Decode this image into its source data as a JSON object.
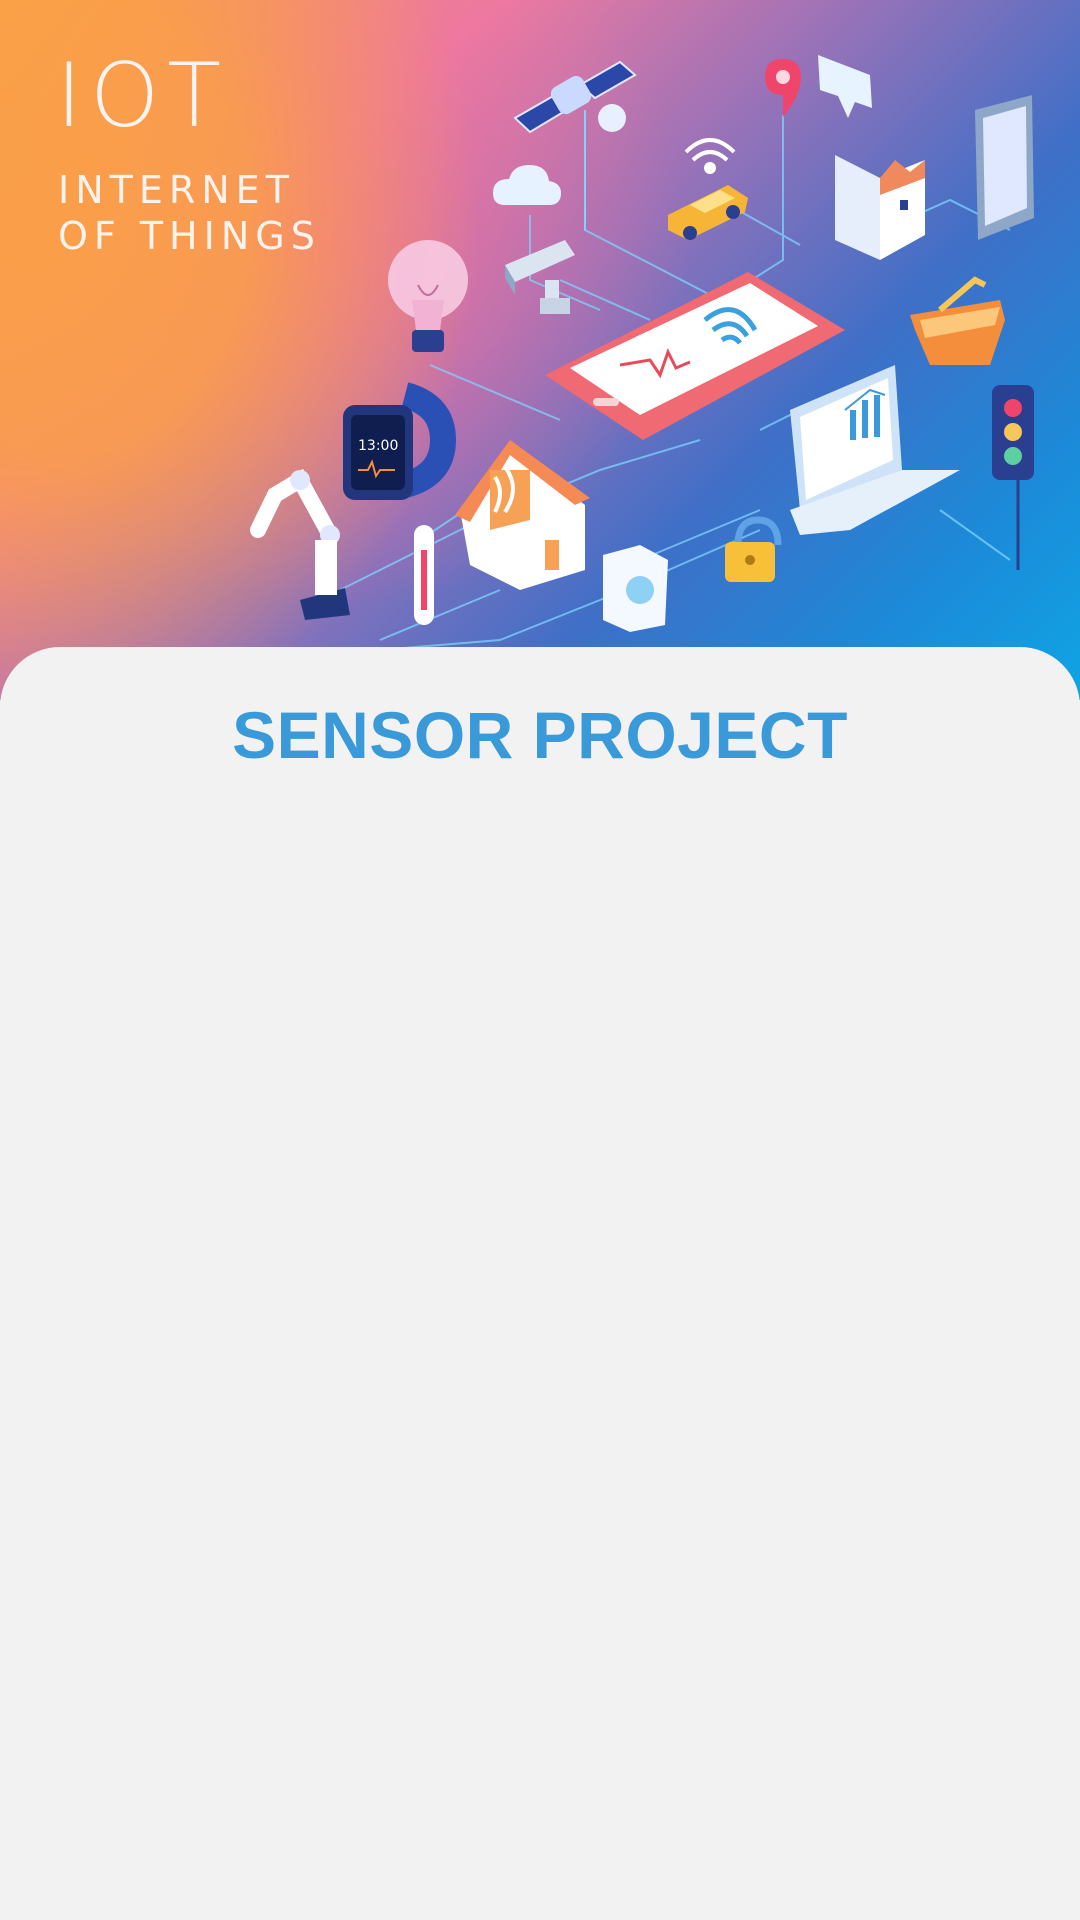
{
  "hero": {
    "title": "IOT",
    "subtitle_line1": "INTERNET",
    "subtitle_line2": "OF THINGS",
    "banner_icons": [
      "satellite-icon",
      "cloud-icon",
      "lightbulb-icon",
      "security-camera-icon",
      "car-icon",
      "wifi-icon",
      "location-pin-icon",
      "chat-bubble-icon",
      "factory-icon",
      "qr-phone-icon",
      "smartphone-icon",
      "shopping-basket-icon",
      "smartwatch-icon",
      "house-icon",
      "laptop-icon",
      "traffic-light-icon",
      "robot-arm-icon",
      "thermometer-icon",
      "washing-machine-icon",
      "padlock-icon"
    ]
  },
  "main": {
    "title": "SENSOR PROJECT"
  },
  "colors": {
    "title": "#3a9ad9",
    "background": "#f2f2f2",
    "hero_orange": "#f7a24a",
    "hero_pink": "#ee7aa0",
    "hero_blue": "#1c8ad8"
  }
}
